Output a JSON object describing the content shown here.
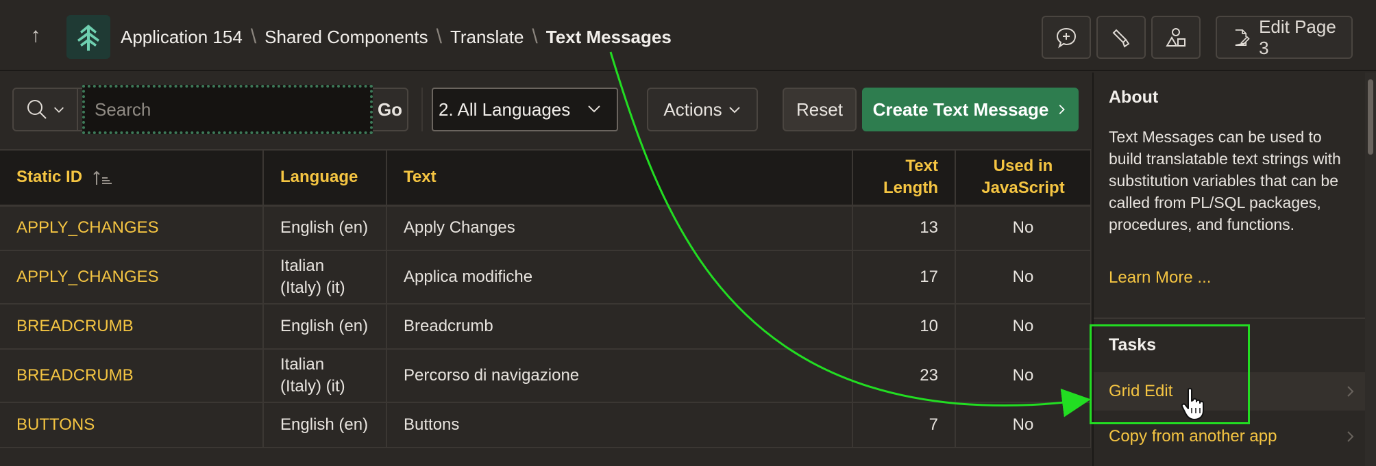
{
  "header": {
    "breadcrumbs": [
      "Application 154",
      "Shared Components",
      "Translate",
      "Text Messages"
    ],
    "edit_page_label": "Edit Page 3"
  },
  "toolbar": {
    "search_placeholder": "Search",
    "go_label": "Go",
    "language_selected": "2. All Languages",
    "actions_label": "Actions",
    "reset_label": "Reset",
    "create_label": "Create Text Message"
  },
  "table": {
    "columns": [
      "Static ID",
      "Language",
      "Text",
      "Text Length",
      "Used in JavaScript"
    ],
    "rows": [
      {
        "static_id": "APPLY_CHANGES",
        "language": "English (en)",
        "text": "Apply Changes",
        "length": "13",
        "used_in_js": "No"
      },
      {
        "static_id": "APPLY_CHANGES",
        "language": "Italian (Italy) (it)",
        "text": "Applica modifiche",
        "length": "17",
        "used_in_js": "No"
      },
      {
        "static_id": "BREADCRUMB",
        "language": "English (en)",
        "text": "Breadcrumb",
        "length": "10",
        "used_in_js": "No"
      },
      {
        "static_id": "BREADCRUMB",
        "language": "Italian (Italy) (it)",
        "text": "Percorso di navigazione",
        "length": "23",
        "used_in_js": "No"
      },
      {
        "static_id": "BUTTONS",
        "language": "English (en)",
        "text": "Buttons",
        "length": "7",
        "used_in_js": "No"
      }
    ]
  },
  "panel": {
    "about_title": "About",
    "about_text": "Text Messages can be used to build translatable text strings with substitution variables that can be called from PL/SQL packages, procedures, and functions.",
    "learn_more": "Learn More ...",
    "tasks_title": "Tasks",
    "tasks": [
      "Grid Edit",
      "Copy from another app"
    ]
  },
  "colors": {
    "accent_gold": "#f5c542",
    "create_button": "#2e7d4f",
    "annotation_green": "#22dd22"
  }
}
